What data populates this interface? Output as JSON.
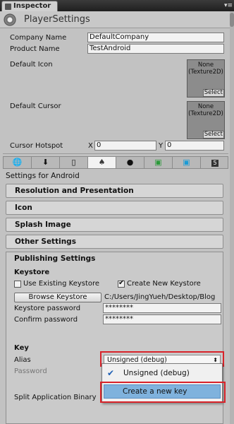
{
  "window": {
    "tab_title": "Inspector",
    "tab_menu_glyph": "▾≡",
    "header_title": "PlayerSettings"
  },
  "fields": {
    "company_name_label": "Company Name",
    "company_name_value": "DefaultCompany",
    "product_name_label": "Product Name",
    "product_name_value": "TestAndroid",
    "default_icon_label": "Default Icon",
    "default_cursor_label": "Default Cursor",
    "texture_none": "None",
    "texture_type": "(Texture2D)",
    "select_label": "Select",
    "cursor_hotspot_label": "Cursor Hotspot",
    "x_label": "X",
    "x_value": "0",
    "y_label": "Y",
    "y_value": "0"
  },
  "platform_tabs": {
    "items": [
      {
        "icon": "globe-icon",
        "glyph": "🌐"
      },
      {
        "icon": "download-icon",
        "glyph": "⬇"
      },
      {
        "icon": "phone-icon",
        "glyph": "▯"
      },
      {
        "icon": "android-icon",
        "glyph": "♠"
      },
      {
        "icon": "blackberry-icon",
        "glyph": "●"
      },
      {
        "icon": "xbox-icon",
        "glyph": "▣"
      },
      {
        "icon": "windows-store-icon",
        "glyph": "▣"
      },
      {
        "icon": "html5-icon",
        "glyph": "5"
      }
    ],
    "active_index": 3
  },
  "settings_for": "Settings for Android",
  "sections": {
    "resolution": "Resolution and Presentation",
    "icon": "Icon",
    "splash": "Splash Image",
    "other": "Other Settings",
    "publishing": "Publishing Settings"
  },
  "keystore": {
    "heading": "Keystore",
    "use_existing_label": "Use Existing Keystore",
    "use_existing_checked": false,
    "create_new_label": "Create New Keystore",
    "create_new_checked": true,
    "browse_button": "Browse Keystore",
    "path": "C:/Users/JingYueh/Desktop/Blog",
    "password_label": "Keystore password",
    "password_value": "********",
    "confirm_label": "Confirm password",
    "confirm_value": "********"
  },
  "key": {
    "heading": "Key",
    "alias_label": "Alias",
    "alias_value": "Unsigned (debug)",
    "password_label": "Password",
    "split_label": "Split Application Binary"
  },
  "alias_menu": {
    "items": [
      "Unsigned (debug)",
      "Create a new key"
    ],
    "checked_index": 0,
    "highlight_index": 1
  },
  "colors": {
    "highlight_border": "#d8232a",
    "menu_highlight": "#7fb2dd",
    "check": "#1e5fb4"
  }
}
